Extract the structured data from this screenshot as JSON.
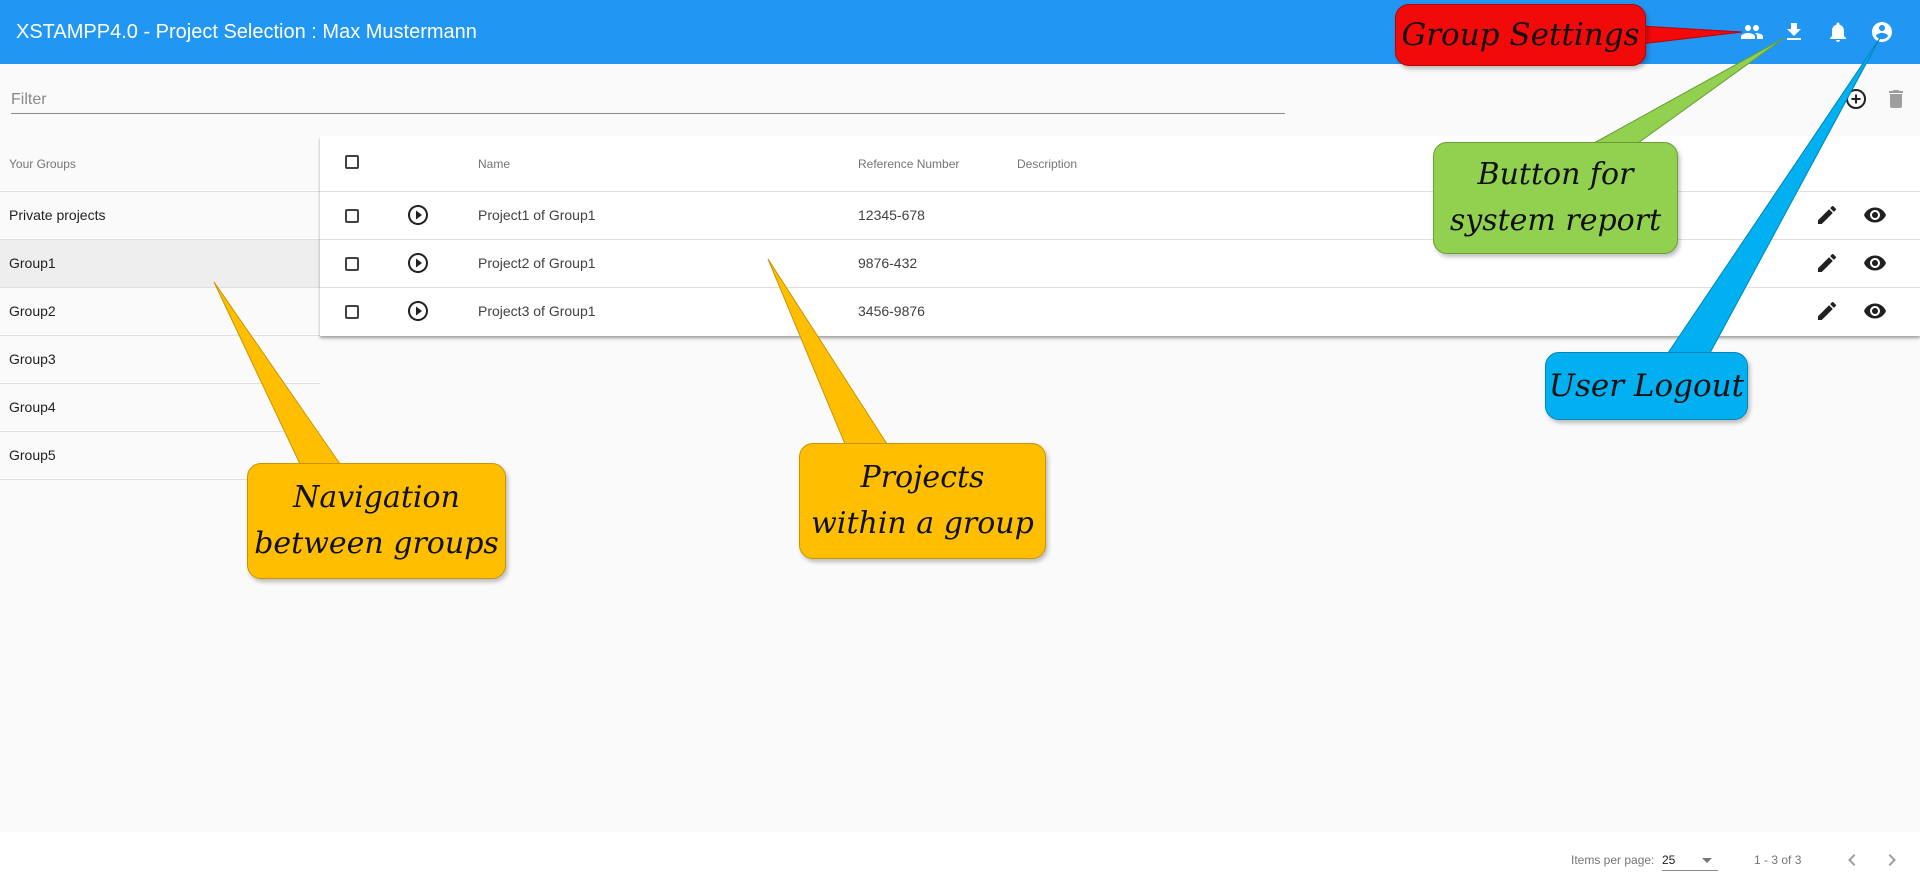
{
  "header": {
    "title": "XSTAMPP4.0 - Project Selection : Max Mustermann",
    "icons": [
      "group-icon",
      "download-icon",
      "bell-icon",
      "account-circle-icon"
    ]
  },
  "filter": {
    "placeholder": "Filter",
    "value": ""
  },
  "toolbar": {
    "add_icon": "add-circle-outline-icon",
    "delete_icon": "trash-icon"
  },
  "groups": {
    "header": "Your Groups",
    "items": [
      "Private projects",
      "Group1",
      "Group2",
      "Group3",
      "Group4",
      "Group5"
    ],
    "selected": "Group1"
  },
  "table": {
    "columns": {
      "name": "Name",
      "reference": "Reference Number",
      "description": "Description"
    },
    "rows": [
      {
        "name": "Project1 of Group1",
        "reference": "12345-678",
        "description": ""
      },
      {
        "name": "Project2 of Group1",
        "reference": "9876-432",
        "description": ""
      },
      {
        "name": "Project3 of Group1",
        "reference": "3456-9876",
        "description": ""
      }
    ],
    "row_icons": [
      "play-circle-icon",
      "pencil-icon",
      "eye-icon"
    ]
  },
  "paginator": {
    "items_per_page_label": "Items per page:",
    "items_per_page_value": "25",
    "range_label": "1 - 3 of 3"
  },
  "callouts": {
    "group_settings": "Group Settings",
    "system_report_line1": "Button for",
    "system_report_line2": "system report",
    "user_logout": "User Logout",
    "navigation_line1": "Navigation",
    "navigation_line2": "between groups",
    "projects_line1": "Projects",
    "projects_line2": "within a group"
  },
  "colors": {
    "app_bar": "#2196f3",
    "callout_red": "#f20a0a",
    "callout_green": "#92d050",
    "callout_blue": "#00b0f0",
    "callout_orange": "#ffbf00"
  }
}
